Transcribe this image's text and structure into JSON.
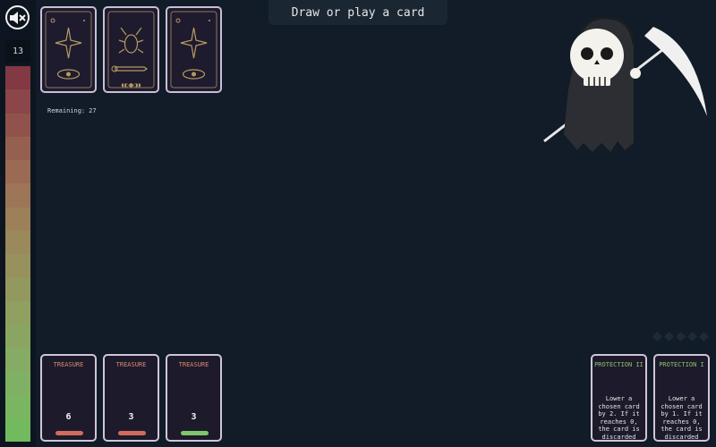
{
  "sidebar": {
    "health_value": "13",
    "health_colors": [
      "#823944",
      "#8a4649",
      "#91524c",
      "#966050",
      "#9a6b52",
      "#9c7657",
      "#9c8059",
      "#9a895b",
      "#97915d",
      "#93985e",
      "#8fa060",
      "#8aa562",
      "#86ab64",
      "#80b063",
      "#7ab661",
      "#73ba5e"
    ],
    "mute_icon": "speaker-mute-icon"
  },
  "prompt": {
    "text": "Draw or play a card"
  },
  "deck": {
    "remaining_label": "Remaining:",
    "remaining_count": "27",
    "backs": [
      {
        "icon": "star-eye-icon"
      },
      {
        "icon": "beetle-sword-icon"
      },
      {
        "icon": "star-eye-icon"
      }
    ]
  },
  "hand": [
    {
      "type": "TREASURE",
      "value": "6",
      "bar_color": "#d36a5e"
    },
    {
      "type": "TREASURE",
      "value": "3",
      "bar_color": "#d36a5e"
    },
    {
      "type": "TREASURE",
      "value": "3",
      "bar_color": "#7fc66a"
    }
  ],
  "protection": [
    {
      "type": "PROTECTION II",
      "desc": "Lower a chosen card by 2. If it reaches 0, the card is discarded"
    },
    {
      "type": "PROTECTION I",
      "desc": "Lower a chosen card by 1. If it reaches 0, the card is discarded"
    }
  ],
  "diamonds": {
    "count": 5,
    "color": "#1e2a36",
    "icon": "diamond-icon"
  },
  "enemy": {
    "icon": "grim-reaper-icon"
  }
}
